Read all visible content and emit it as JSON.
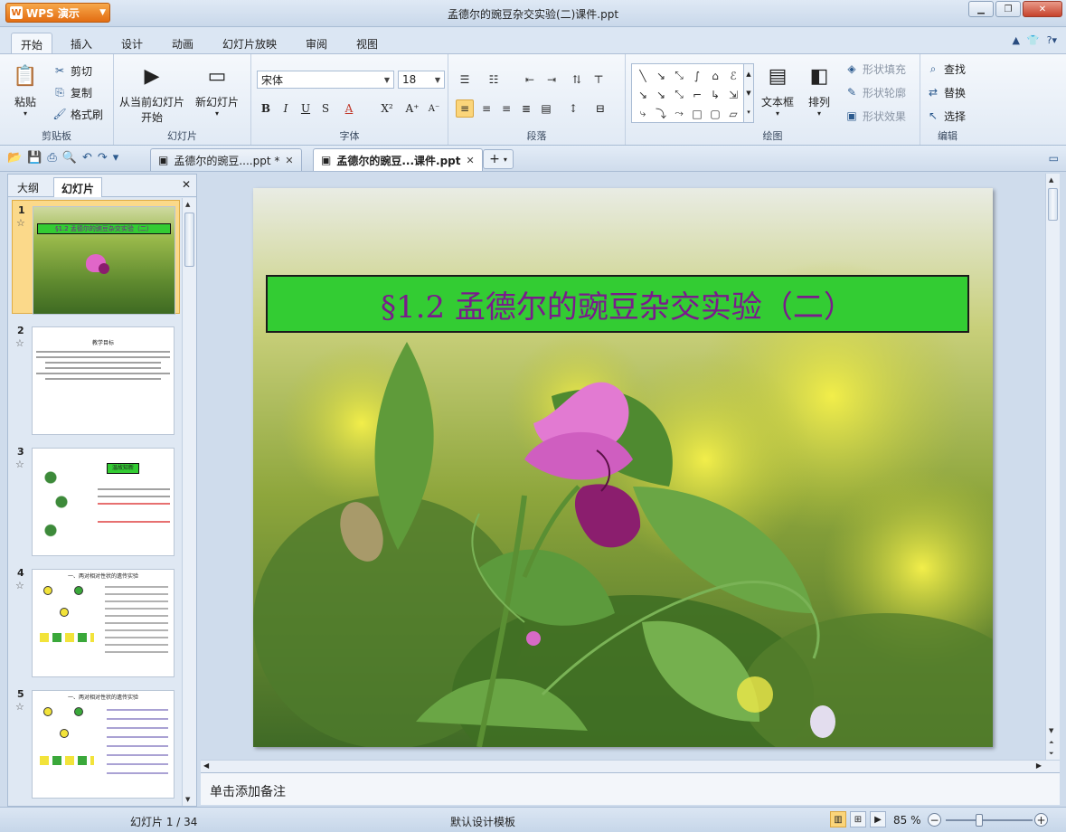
{
  "app": {
    "name": "WPS 演示",
    "window_title": "孟德尔的豌豆杂交实验(二)课件.ppt"
  },
  "menu_tabs": [
    "开始",
    "插入",
    "设计",
    "动画",
    "幻灯片放映",
    "审阅",
    "视图"
  ],
  "ribbon": {
    "clipboard": {
      "paste": "粘贴",
      "cut": "剪切",
      "copy": "复制",
      "format_painter": "格式刷",
      "label": "剪贴板"
    },
    "slides": {
      "start_from_current_line1": "从当前幻灯片",
      "start_from_current_line2": "开始",
      "new_slide": "新幻灯片",
      "label": "幻灯片"
    },
    "font": {
      "family": "宋体",
      "size": "18",
      "label": "字体"
    },
    "paragraph": {
      "label": "段落"
    },
    "drawing": {
      "textbox": "文本框",
      "arrange": "排列",
      "shape_fill": "形状填充",
      "shape_outline": "形状轮廓",
      "shape_effect": "形状效果",
      "label": "绘图"
    },
    "editing": {
      "find": "查找",
      "replace": "替换",
      "select": "选择",
      "label": "编辑"
    }
  },
  "doc_tabs": [
    {
      "label": "孟德尔的豌豆....ppt *",
      "active": false
    },
    {
      "label": "孟德尔的豌豆...课件.ppt",
      "active": true
    }
  ],
  "left_panel": {
    "tab_outline": "大纲",
    "tab_slides": "幻灯片"
  },
  "thumbnails": [
    {
      "num": "1",
      "title": "§1.2 孟德尔的豌豆杂交实验（二）"
    },
    {
      "num": "2",
      "text": "教学目标"
    },
    {
      "num": "3",
      "text": "温故知新"
    },
    {
      "num": "4",
      "text": "一、两对相对性状的遗传实验"
    },
    {
      "num": "5",
      "text": "一、两对相对性状的遗传实验"
    }
  ],
  "slide": {
    "title": "§1.2 孟德尔的豌豆杂交实验（二）"
  },
  "notes_placeholder": "单击添加备注",
  "status": {
    "slide_count": "幻灯片 1 / 34",
    "template": "默认设计模板",
    "zoom": "85 %"
  }
}
